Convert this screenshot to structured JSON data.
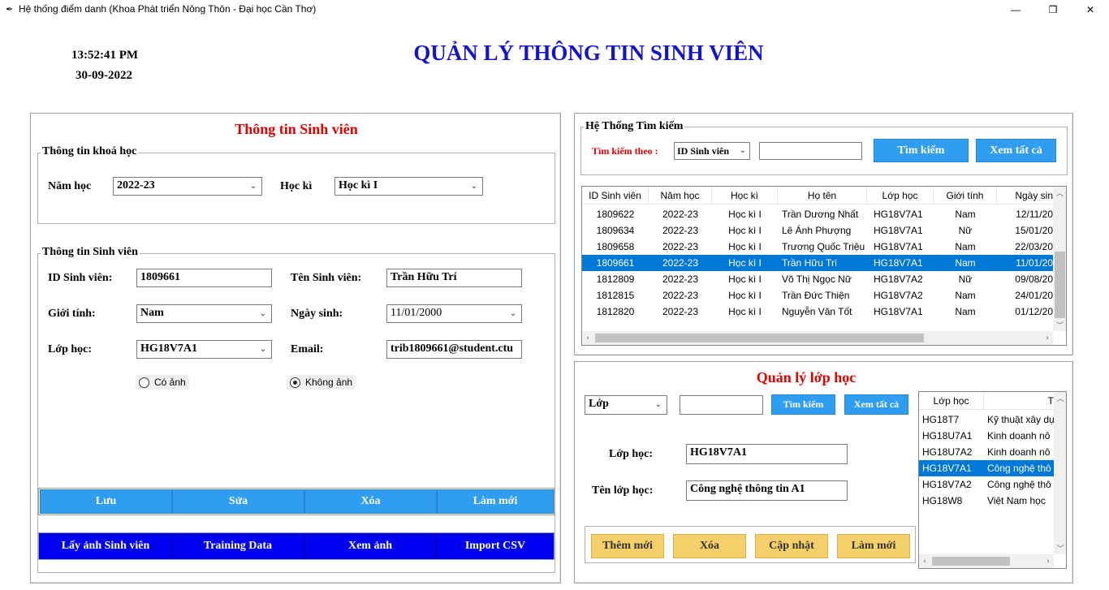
{
  "window": {
    "title": "Hệ thống điểm danh (Khoa Phát triển Nông Thôn - Đại học Cần Thơ)",
    "minimize": "—",
    "maximize": "❐",
    "close": "✕"
  },
  "clock": {
    "time": "13:52:41 PM",
    "date": "30-09-2022"
  },
  "main_title": "QUẢN LÝ THÔNG TIN SINH VIÊN",
  "student_panel": {
    "title": "Thông tin Sinh viên",
    "course_group": {
      "label": "Thông tin khoá học",
      "year_label": "Năm học",
      "year_value": "2022-23",
      "semester_label": "Học kì",
      "semester_value": "Học kì I"
    },
    "info_group": {
      "label": "Thông tin Sinh viên",
      "id_label": "ID Sinh viên:",
      "id_value": "1809661",
      "name_label": "Tên Sinh viên:",
      "name_value": "Trần Hữu Trí",
      "gender_label": "Giới tính:",
      "gender_value": "Nam",
      "dob_label": "Ngày sinh:",
      "dob_value": "11/01/2000",
      "class_label": "Lớp học:",
      "class_value": "HG18V7A1",
      "email_label": "Email:",
      "email_value": "trib1809661@student.ctu",
      "radio_with_photo": "Có ảnh",
      "radio_no_photo": "Không ảnh"
    },
    "actions": [
      "Lưu",
      "Sửa",
      "Xóa",
      "Làm mới"
    ],
    "photo_actions": [
      "Lấy ảnh Sinh viên",
      "Training Data",
      "Xem ảnh",
      "Import CSV"
    ]
  },
  "search_panel": {
    "group_label": "Hệ Thống Tìm kiếm",
    "search_by_label": "Tìm kiếm theo :",
    "search_by_value": "ID Sinh viên",
    "search_value": "",
    "search_button": "Tìm kiếm",
    "view_all_button": "Xem tất cả",
    "columns": [
      "ID Sinh viên",
      "Năm học",
      "Học kì",
      "Họ tên",
      "Lớp học",
      "Giới tính",
      "Ngày sin"
    ],
    "rows": [
      [
        "1809622",
        "2022-23",
        "Học kì I",
        "Trần Dương Nhất",
        "HG18V7A1",
        "Nam",
        "12/11/20"
      ],
      [
        "1809634",
        "2022-23",
        "Học kì I",
        "Lê Ánh Phượng",
        "HG18V7A1",
        "Nữ",
        "15/01/20"
      ],
      [
        "1809658",
        "2022-23",
        "Học kì I",
        "Trương Quốc Triệu",
        "HG18V7A1",
        "Nam",
        "22/03/20"
      ],
      [
        "1809661",
        "2022-23",
        "Học kì I",
        "Trần Hữu Trí",
        "HG18V7A1",
        "Nam",
        "11/01/20"
      ],
      [
        "1812809",
        "2022-23",
        "Học kì I",
        "Võ Thị Ngọc Nữ",
        "HG18V7A2",
        "Nữ",
        "09/08/20"
      ],
      [
        "1812815",
        "2022-23",
        "Học kì I",
        "Trần Đức Thiện",
        "HG18V7A2",
        "Nam",
        "24/01/20"
      ],
      [
        "1812820",
        "2022-23",
        "Học kì I",
        "Nguyễn Văn Tốt",
        "HG18V7A1",
        "Nam",
        "01/12/20"
      ]
    ]
  },
  "class_panel": {
    "title": "Quản lý lớp học",
    "filter_value": "Lớp",
    "filter_search": "",
    "search_button": "Tìm kiếm",
    "view_all_button": "Xem tất cả",
    "class_label": "Lớp học:",
    "class_value": "HG18V7A1",
    "class_name_label": "Tên lớp học:",
    "class_name_value": "Công nghệ thông tin A1",
    "buttons": [
      "Thêm mới",
      "Xóa",
      "Cập nhật",
      "Làm mới"
    ],
    "columns": [
      "Lớp học",
      "T"
    ],
    "rows": [
      [
        "HG18T7",
        "Kỹ thuật xây dự"
      ],
      [
        "HG18U7A1",
        "Kinh doanh nô"
      ],
      [
        "HG18U7A2",
        "Kinh doanh nô"
      ],
      [
        "HG18V7A1",
        "Công nghệ thô"
      ],
      [
        "HG18V7A2",
        "Công nghệ thô"
      ],
      [
        "HG18W8",
        "Việt Nam học"
      ]
    ]
  }
}
